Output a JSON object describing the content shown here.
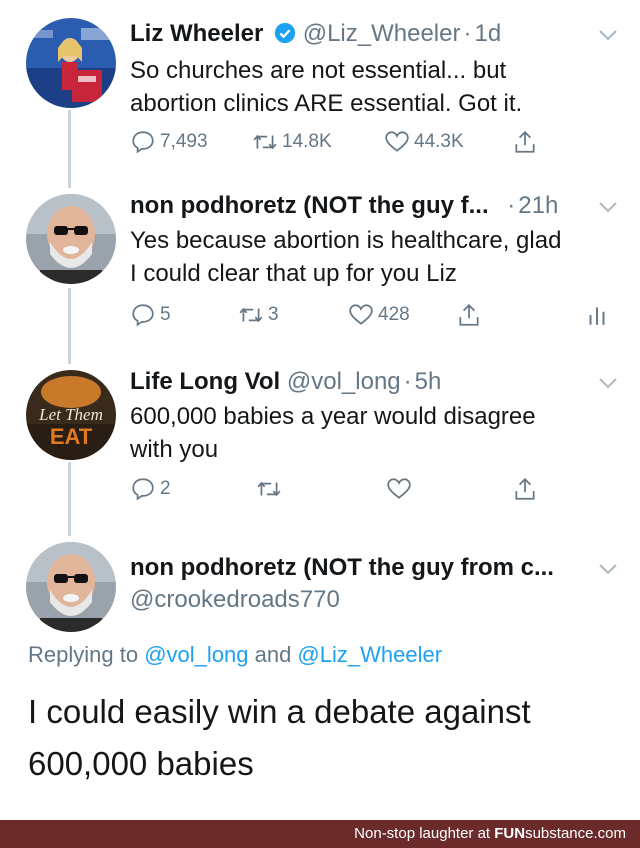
{
  "tweets": [
    {
      "name": "Liz Wheeler",
      "handle": "@Liz_Wheeler",
      "time": "1d",
      "text1": "So churches are not essential... but",
      "text2": "abortion clinics ARE essential. Got it.",
      "replies": "7,493",
      "retweets": "14.8K",
      "likes": "44.3K"
    },
    {
      "name": "non podhoretz (NOT the guy f...",
      "time": "21h",
      "text1": "Yes because abortion is healthcare, glad",
      "text2": "I could clear that up for you Liz",
      "replies": "5",
      "retweets": "3",
      "likes": "428"
    },
    {
      "name": "Life Long Vol",
      "handle": "@vol_long",
      "time": "5h",
      "text1": "600,000 babies a year would disagree",
      "text2": "with you",
      "replies": "2",
      "avatar_text1": "Let Them",
      "avatar_text2": "EAT"
    },
    {
      "name": "non podhoretz (NOT the guy from c...",
      "handle": "@crookedroads770",
      "replying_prefix": "Replying to ",
      "replying_user1": "@vol_long",
      "replying_and": " and ",
      "replying_user2": "@Liz_Wheeler",
      "text1": "I could easily win a debate against",
      "text2": "600,000 babies"
    }
  ],
  "footer": {
    "prefix": "Non-stop laughter at ",
    "brand": "FUN",
    "brand_rest": "substance",
    "suffix": ".com"
  },
  "colors": {
    "accent": "#1da1f2",
    "muted": "#657786",
    "footer_bg": "#6b2b2b"
  }
}
